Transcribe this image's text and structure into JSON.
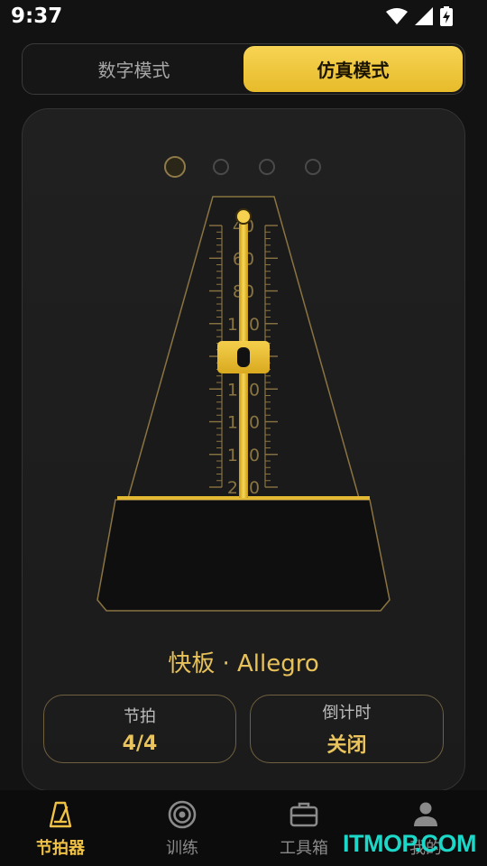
{
  "status_bar": {
    "time": "9:37"
  },
  "mode_switch": {
    "digital_label": "数字模式",
    "analog_label": "仿真模式",
    "selected": "仿真模式"
  },
  "pager": {
    "count": 4,
    "active_index": 0
  },
  "metronome": {
    "scale_labels": [
      "40",
      "60",
      "80",
      "100",
      "120",
      "140",
      "160",
      "180",
      "200"
    ],
    "colors": {
      "gold": "#e8bd2f",
      "gold_light": "#f7d454",
      "outline": "#8a7442"
    }
  },
  "tempo": {
    "name": "快板 · Allegro"
  },
  "beat": {
    "label": "节拍",
    "value": "4/4"
  },
  "timer": {
    "label": "倒计时",
    "value": "关闭"
  },
  "nav": {
    "items": [
      {
        "label": "节拍器",
        "icon": "metronome-icon",
        "active": true
      },
      {
        "label": "训练",
        "icon": "target-icon",
        "active": false
      },
      {
        "label": "工具箱",
        "icon": "toolbox-icon",
        "active": false
      },
      {
        "label": "我的",
        "icon": "person-icon",
        "active": false
      }
    ]
  },
  "watermark": "ITMOP.COM"
}
